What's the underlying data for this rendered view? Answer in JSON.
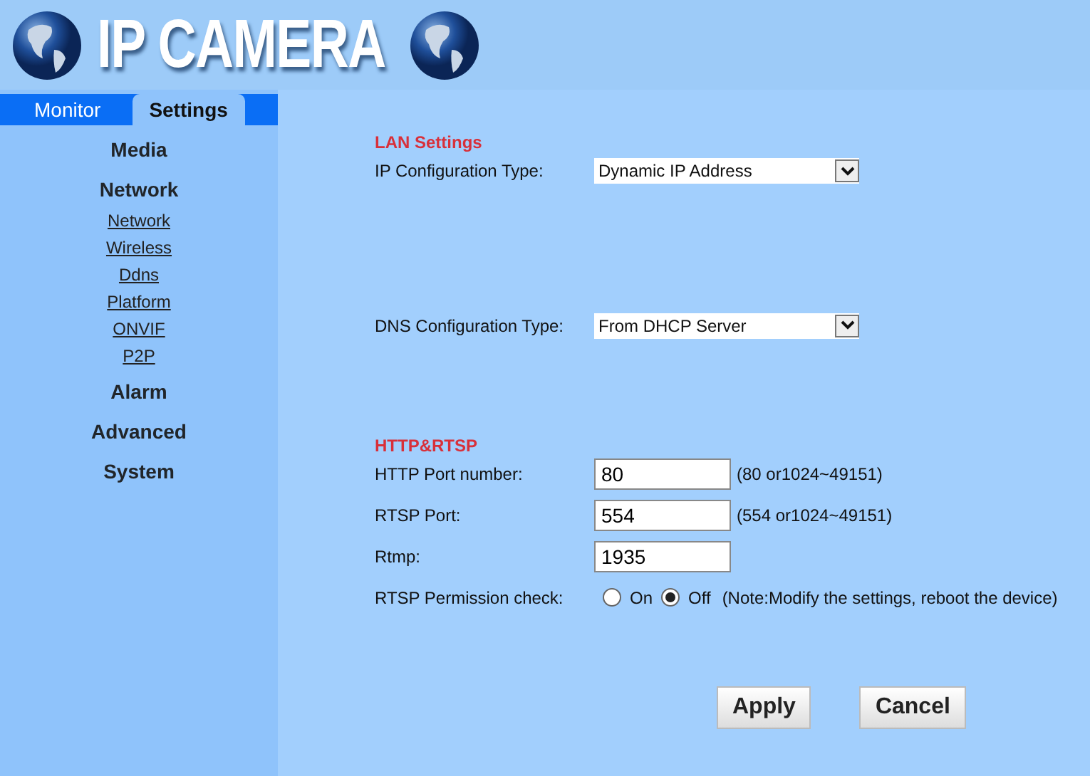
{
  "header": {
    "title": "IP CAMERA"
  },
  "tabs": [
    {
      "label": "Monitor",
      "selected": false
    },
    {
      "label": "Settings",
      "selected": true
    }
  ],
  "menu": [
    {
      "label": "Media"
    },
    {
      "label": "Network",
      "children": [
        "Network",
        "Wireless",
        "Ddns",
        "Platform",
        "ONVIF",
        "P2P"
      ]
    },
    {
      "label": "Alarm"
    },
    {
      "label": "Advanced"
    },
    {
      "label": "System"
    }
  ],
  "lan": {
    "heading": "LAN Settings",
    "ip_type": {
      "label": "IP Configuration Type:",
      "value": "Dynamic IP Address"
    },
    "dns_type": {
      "label": "DNS Configuration Type:",
      "value": "From DHCP Server"
    }
  },
  "http_rtsp": {
    "heading": "HTTP&RTSP",
    "fields": [
      {
        "label": "HTTP Port number:",
        "value": "80",
        "hint": "(80 or1024~49151)"
      },
      {
        "label": "RTSP Port:",
        "value": "554",
        "hint": "(554 or1024~49151)"
      },
      {
        "label": "Rtmp:",
        "value": "1935"
      }
    ],
    "permission": {
      "label": "RTSP Permission check:",
      "options": [
        {
          "label": "On",
          "selected": false
        },
        {
          "label": "Off",
          "selected": true
        }
      ],
      "note": "(Note:Modify the settings, reboot the device)"
    }
  },
  "buttons": [
    "Apply",
    "Cancel"
  ]
}
